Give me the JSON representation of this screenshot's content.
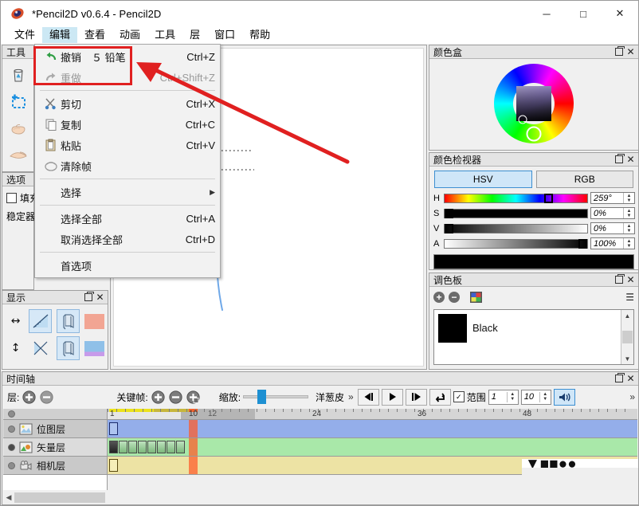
{
  "window": {
    "title": "*Pencil2D v0.6.4 - Pencil2D",
    "app_icon": "pencil2d-logo-icon",
    "minimize": "─",
    "maximize": "□",
    "close": "✕"
  },
  "menubar": {
    "items": [
      {
        "label": "文件",
        "active": false
      },
      {
        "label": "编辑",
        "active": true
      },
      {
        "label": "查看",
        "active": false
      },
      {
        "label": "动画",
        "active": false
      },
      {
        "label": "工具",
        "active": false
      },
      {
        "label": "层",
        "active": false
      },
      {
        "label": "窗口",
        "active": false
      },
      {
        "label": "帮助",
        "active": false
      }
    ]
  },
  "edit_menu": {
    "items": [
      {
        "label": "撤销　５ 铅笔",
        "accel": "Ctrl+Z",
        "icon": "undo-arrow-icon",
        "disabled": false,
        "submenu": false
      },
      {
        "label": "重做",
        "accel": "Ctrl+Shift+Z",
        "icon": "redo-arrow-icon",
        "disabled": true,
        "submenu": false
      },
      {
        "sep": true
      },
      {
        "label": "剪切",
        "accel": "Ctrl+X",
        "icon": "scissors-icon",
        "disabled": false,
        "submenu": false
      },
      {
        "label": "复制",
        "accel": "Ctrl+C",
        "icon": "copy-icon",
        "disabled": false,
        "submenu": false
      },
      {
        "label": "粘贴",
        "accel": "Ctrl+V",
        "icon": "paste-icon",
        "disabled": false,
        "submenu": false
      },
      {
        "label": "清除帧",
        "accel": "",
        "icon": "clear-frame-icon",
        "disabled": false,
        "submenu": false
      },
      {
        "sep": true
      },
      {
        "label": "选择",
        "accel": "",
        "icon": "",
        "disabled": false,
        "submenu": true
      },
      {
        "sep": true
      },
      {
        "label": "选择全部",
        "accel": "Ctrl+A",
        "icon": "",
        "disabled": false,
        "submenu": false
      },
      {
        "label": "取消选择全部",
        "accel": "Ctrl+D",
        "icon": "",
        "disabled": false,
        "submenu": false
      },
      {
        "sep": true
      },
      {
        "label": "首选项",
        "accel": "",
        "icon": "",
        "disabled": false,
        "submenu": false
      }
    ],
    "submenu_arrow": "▶"
  },
  "annotation": {
    "highlight_color": "#e02020",
    "arrow_color": "#e02020"
  },
  "tools_panel": {
    "title": "工具",
    "buttons": [
      {
        "name": "eraser-tool",
        "selected": true
      },
      {
        "name": "select-tool",
        "selected": false
      },
      {
        "name": "hand-tool",
        "selected": false
      },
      {
        "name": "smudge-tool",
        "selected": false
      }
    ]
  },
  "options_panel": {
    "title": "选项",
    "fill_label": "填充",
    "stabilizer_label": "稳定器",
    "fill_checked": false
  },
  "display_panel": {
    "title": "显示",
    "close_icon": "close-icon",
    "float_icon": "float-icon",
    "rows": [
      {
        "arrow": "↔",
        "cells": [
          {
            "name": "horizontal-perspective-icon",
            "on": true
          },
          {
            "name": "horizontal-overlay-icon",
            "on": true
          }
        ],
        "swatch": "#f2a593"
      },
      {
        "arrow": "↕",
        "cells": [
          {
            "name": "vertical-perspective-icon",
            "on": false
          },
          {
            "name": "vertical-overlay-icon",
            "on": true
          }
        ],
        "swatch": "#8fc0e8"
      }
    ]
  },
  "colorbox_panel": {
    "title": "颜色盒",
    "wheel_icon": "color-wheel",
    "square_icon": "sv-square"
  },
  "color_inspector": {
    "title": "颜色检视器",
    "mode_hsv": "HSV",
    "mode_rgb": "RGB",
    "active_mode": "HSV",
    "channels": [
      {
        "label": "H",
        "value": "259°",
        "pct": 72
      },
      {
        "label": "S",
        "value": "0%",
        "pct": 0
      },
      {
        "label": "V",
        "value": "0%",
        "pct": 0
      },
      {
        "label": "A",
        "value": "100%",
        "pct": 100
      }
    ],
    "preview_color": "#000000"
  },
  "palette_panel": {
    "title": "调色板",
    "add_icon": "plus-icon",
    "remove_icon": "minus-icon",
    "picker_icon": "palette-picker-icon",
    "menu_icon": "list-options-icon",
    "colors": [
      {
        "name": "Black",
        "hex": "#000000"
      }
    ]
  },
  "timeline": {
    "title": "时间轴",
    "layer_label": "层:",
    "add_layer_icon": "add-layer-icon",
    "remove_layer_icon": "remove-layer-icon",
    "keyframe_label": "关键帧:",
    "kf_add_icon": "add-keyframe-icon",
    "kf_remove_icon": "remove-keyframe-icon",
    "kf_duplicate_icon": "duplicate-keyframe-icon",
    "zoom_label": "缩放:",
    "zoom_value": 22,
    "onion_label": "洋葱皮",
    "overflow_chevron": "»",
    "playback": [
      {
        "name": "prev-frame-button",
        "glyph": "◀|",
        "on": false
      },
      {
        "name": "play-button",
        "glyph": "▶",
        "on": false
      },
      {
        "name": "next-frame-button",
        "glyph": "|▶",
        "on": false
      },
      {
        "name": "loop-button",
        "glyph": "↺",
        "on": false
      }
    ],
    "range_label": "范围",
    "range_checked": true,
    "range_start": "1",
    "range_end": "10",
    "sound_button": {
      "name": "sound-toggle-button",
      "glyph": "🔊",
      "on": true
    },
    "ruler_marks": [
      "1",
      "10",
      "12",
      "24",
      "36",
      "48"
    ],
    "current_frame": 10,
    "layers": [
      {
        "name": "位图层",
        "icon": "bitmap-layer-icon",
        "visible": false,
        "color": "#94aeea",
        "selected": false,
        "keyframes": [
          1
        ]
      },
      {
        "name": "矢量层",
        "icon": "vector-layer-icon",
        "visible": true,
        "color": "#a9e8a9",
        "selected": true,
        "keyframes": [
          1,
          2,
          3,
          4,
          5,
          6,
          7,
          8
        ]
      },
      {
        "name": "相机层",
        "icon": "camera-layer-icon",
        "visible": false,
        "color": "#ede3a4",
        "selected": false,
        "keyframes": [
          1
        ]
      }
    ]
  },
  "canvas": {
    "drawing_name": "vector-line-drawing"
  }
}
